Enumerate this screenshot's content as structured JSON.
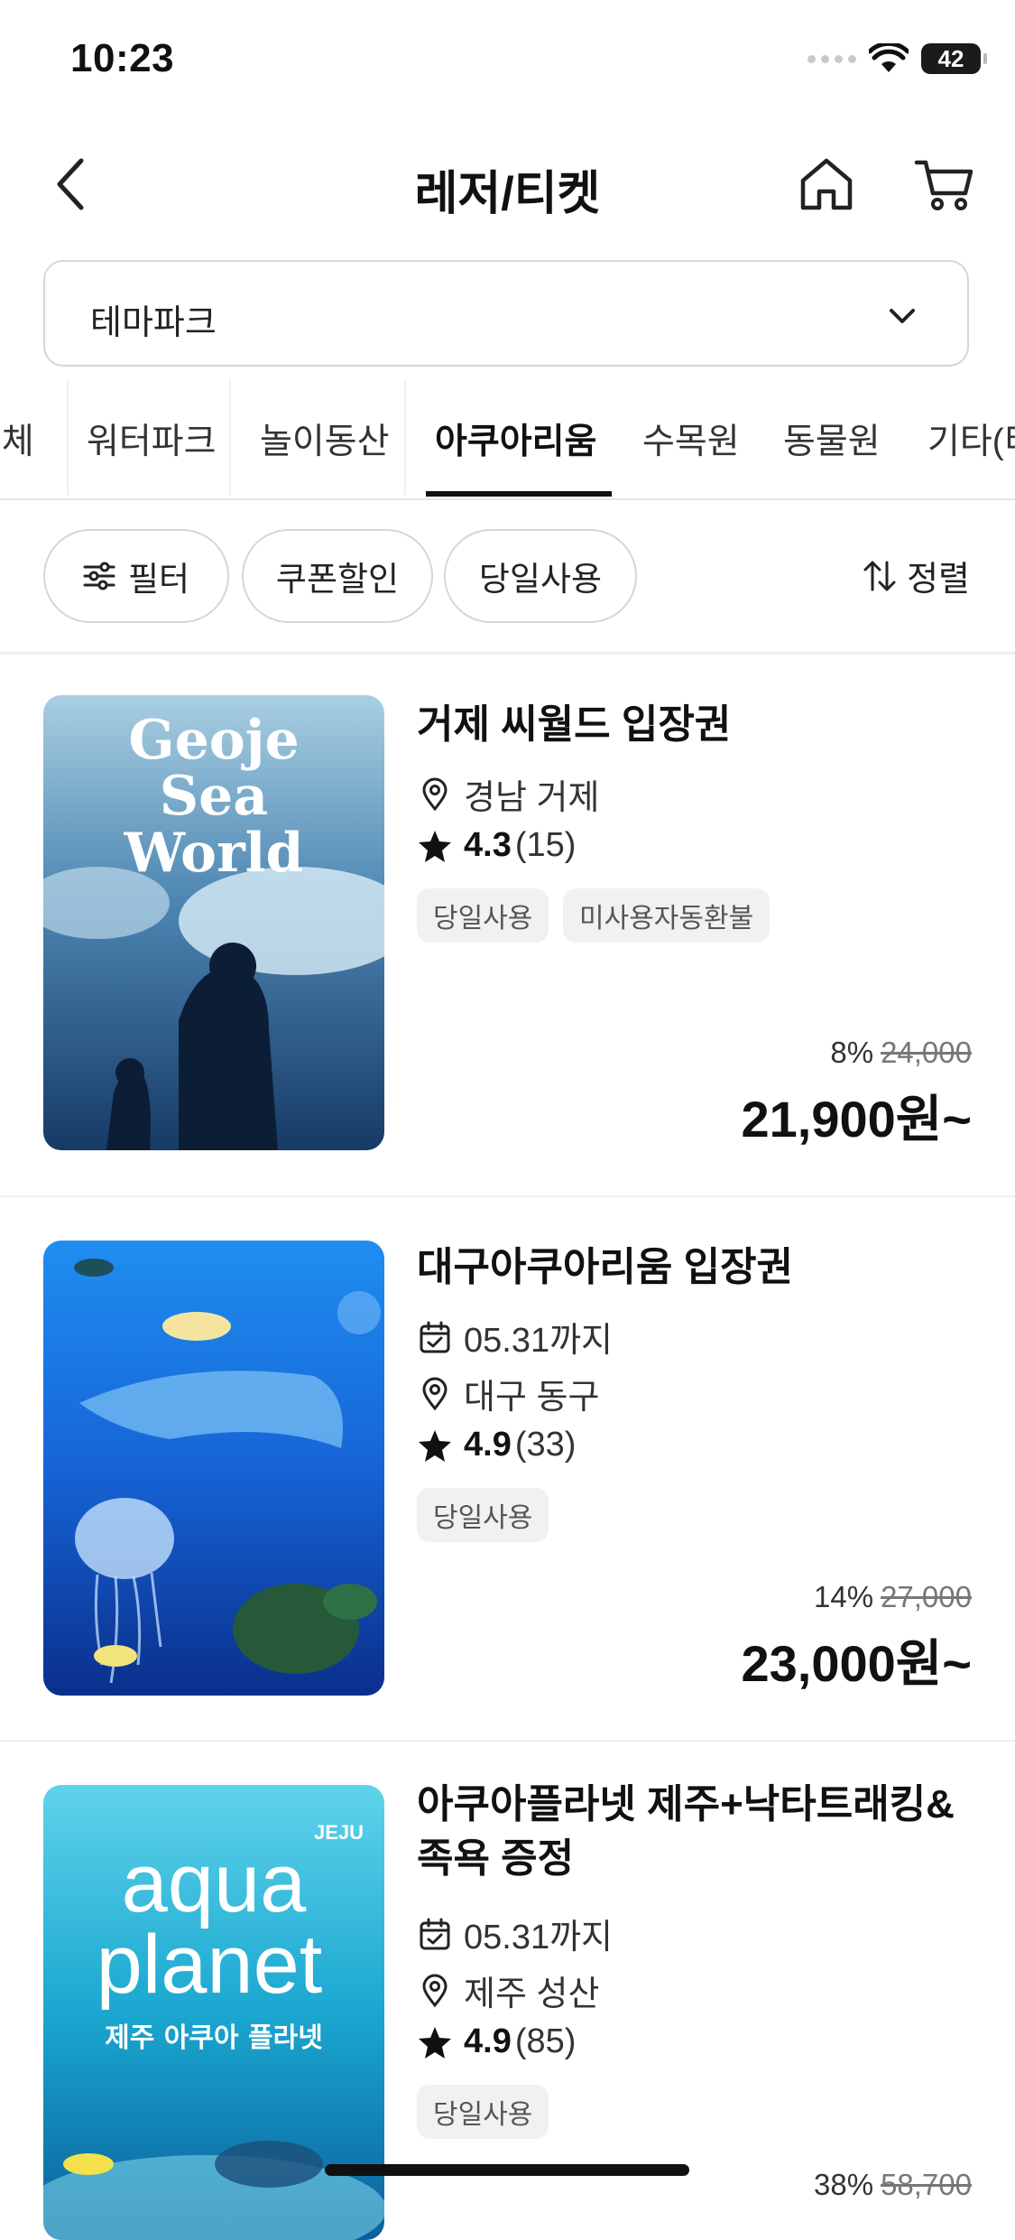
{
  "status_bar": {
    "time": "10:23",
    "battery": "42"
  },
  "header": {
    "title": "레저/티켓"
  },
  "category_select": {
    "value": "테마파크"
  },
  "tabs": [
    {
      "label": "전체"
    },
    {
      "label": "워터파크"
    },
    {
      "label": "놀이동산"
    },
    {
      "label": "아쿠아리움",
      "active": true
    },
    {
      "label": "수목원"
    },
    {
      "label": "동물원"
    },
    {
      "label": "기타(티"
    }
  ],
  "filters": {
    "filter_label": "필터",
    "coupon_label": "쿠폰할인",
    "sameday_label": "당일사용",
    "sort_label": "정렬"
  },
  "products": [
    {
      "title": "거제 씨월드 입장권",
      "location": "경남 거제",
      "rating": "4.3",
      "reviews": "(15)",
      "tags": [
        "당일사용",
        "미사용자동환불"
      ],
      "discount": "8%",
      "original_price": "24,000",
      "price": "21,900원~",
      "image_text": "Geoje Sea World"
    },
    {
      "title": "대구아쿠아리움 입장권",
      "period": "05.31까지",
      "location": "대구 동구",
      "rating": "4.9",
      "reviews": "(33)",
      "tags": [
        "당일사용"
      ],
      "discount": "14%",
      "original_price": "27,000",
      "price": "23,000원~"
    },
    {
      "title_line1": "아쿠아플라넷 제주+낙타트래킹&",
      "title_line2": "족욕 증정",
      "period": "05.31까지",
      "location": "제주 성산",
      "rating": "4.9",
      "reviews": "(85)",
      "tags": [
        "당일사용"
      ],
      "discount": "38%",
      "original_price": "58,700",
      "image_text_top": "JEJU",
      "image_text_1": "aqua",
      "image_text_2": "planet",
      "image_text_ko": "제주 아쿠아 플라넷"
    }
  ],
  "colors": {
    "text": "#111111",
    "chip_border": "#d6d6d6",
    "tag_bg": "#f1f1f3"
  }
}
